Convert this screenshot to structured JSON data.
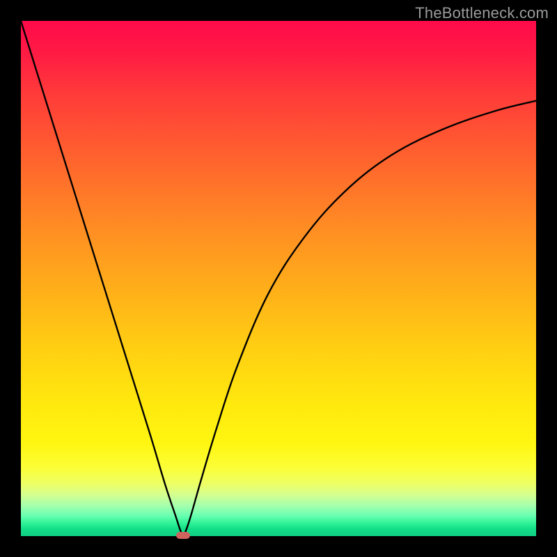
{
  "watermark": "TheBottleneck.com",
  "colors": {
    "background": "#000000",
    "curve": "#000000",
    "marker": "#d1635f"
  },
  "chart_data": {
    "type": "line",
    "title": "",
    "xlabel": "",
    "ylabel": "",
    "xlim": [
      0,
      100
    ],
    "ylim": [
      0,
      100
    ],
    "grid": false,
    "axes_visible": false,
    "background_gradient": {
      "orientation": "vertical",
      "top_color": "#ff0a4a",
      "bottom_color": "#0ed084",
      "meaning": "top=high bottleneck, bottom=low bottleneck"
    },
    "series": [
      {
        "name": "bottleneck-curve",
        "x": [
          0,
          5,
          10,
          15,
          20,
          25,
          28,
          30,
          31,
          31.5,
          32,
          33,
          35,
          38,
          42,
          48,
          55,
          63,
          72,
          82,
          92,
          100
        ],
        "y": [
          100,
          84,
          68,
          52,
          36,
          20,
          10,
          4,
          1,
          0.2,
          1,
          4,
          11,
          21,
          33,
          47,
          58,
          67,
          74,
          79,
          82.5,
          84.5
        ]
      }
    ],
    "annotations": [
      {
        "name": "minimum-bottleneck-marker",
        "x": 31.5,
        "y": 0.2,
        "shape": "rounded-rect",
        "color": "#d1635f"
      }
    ]
  }
}
